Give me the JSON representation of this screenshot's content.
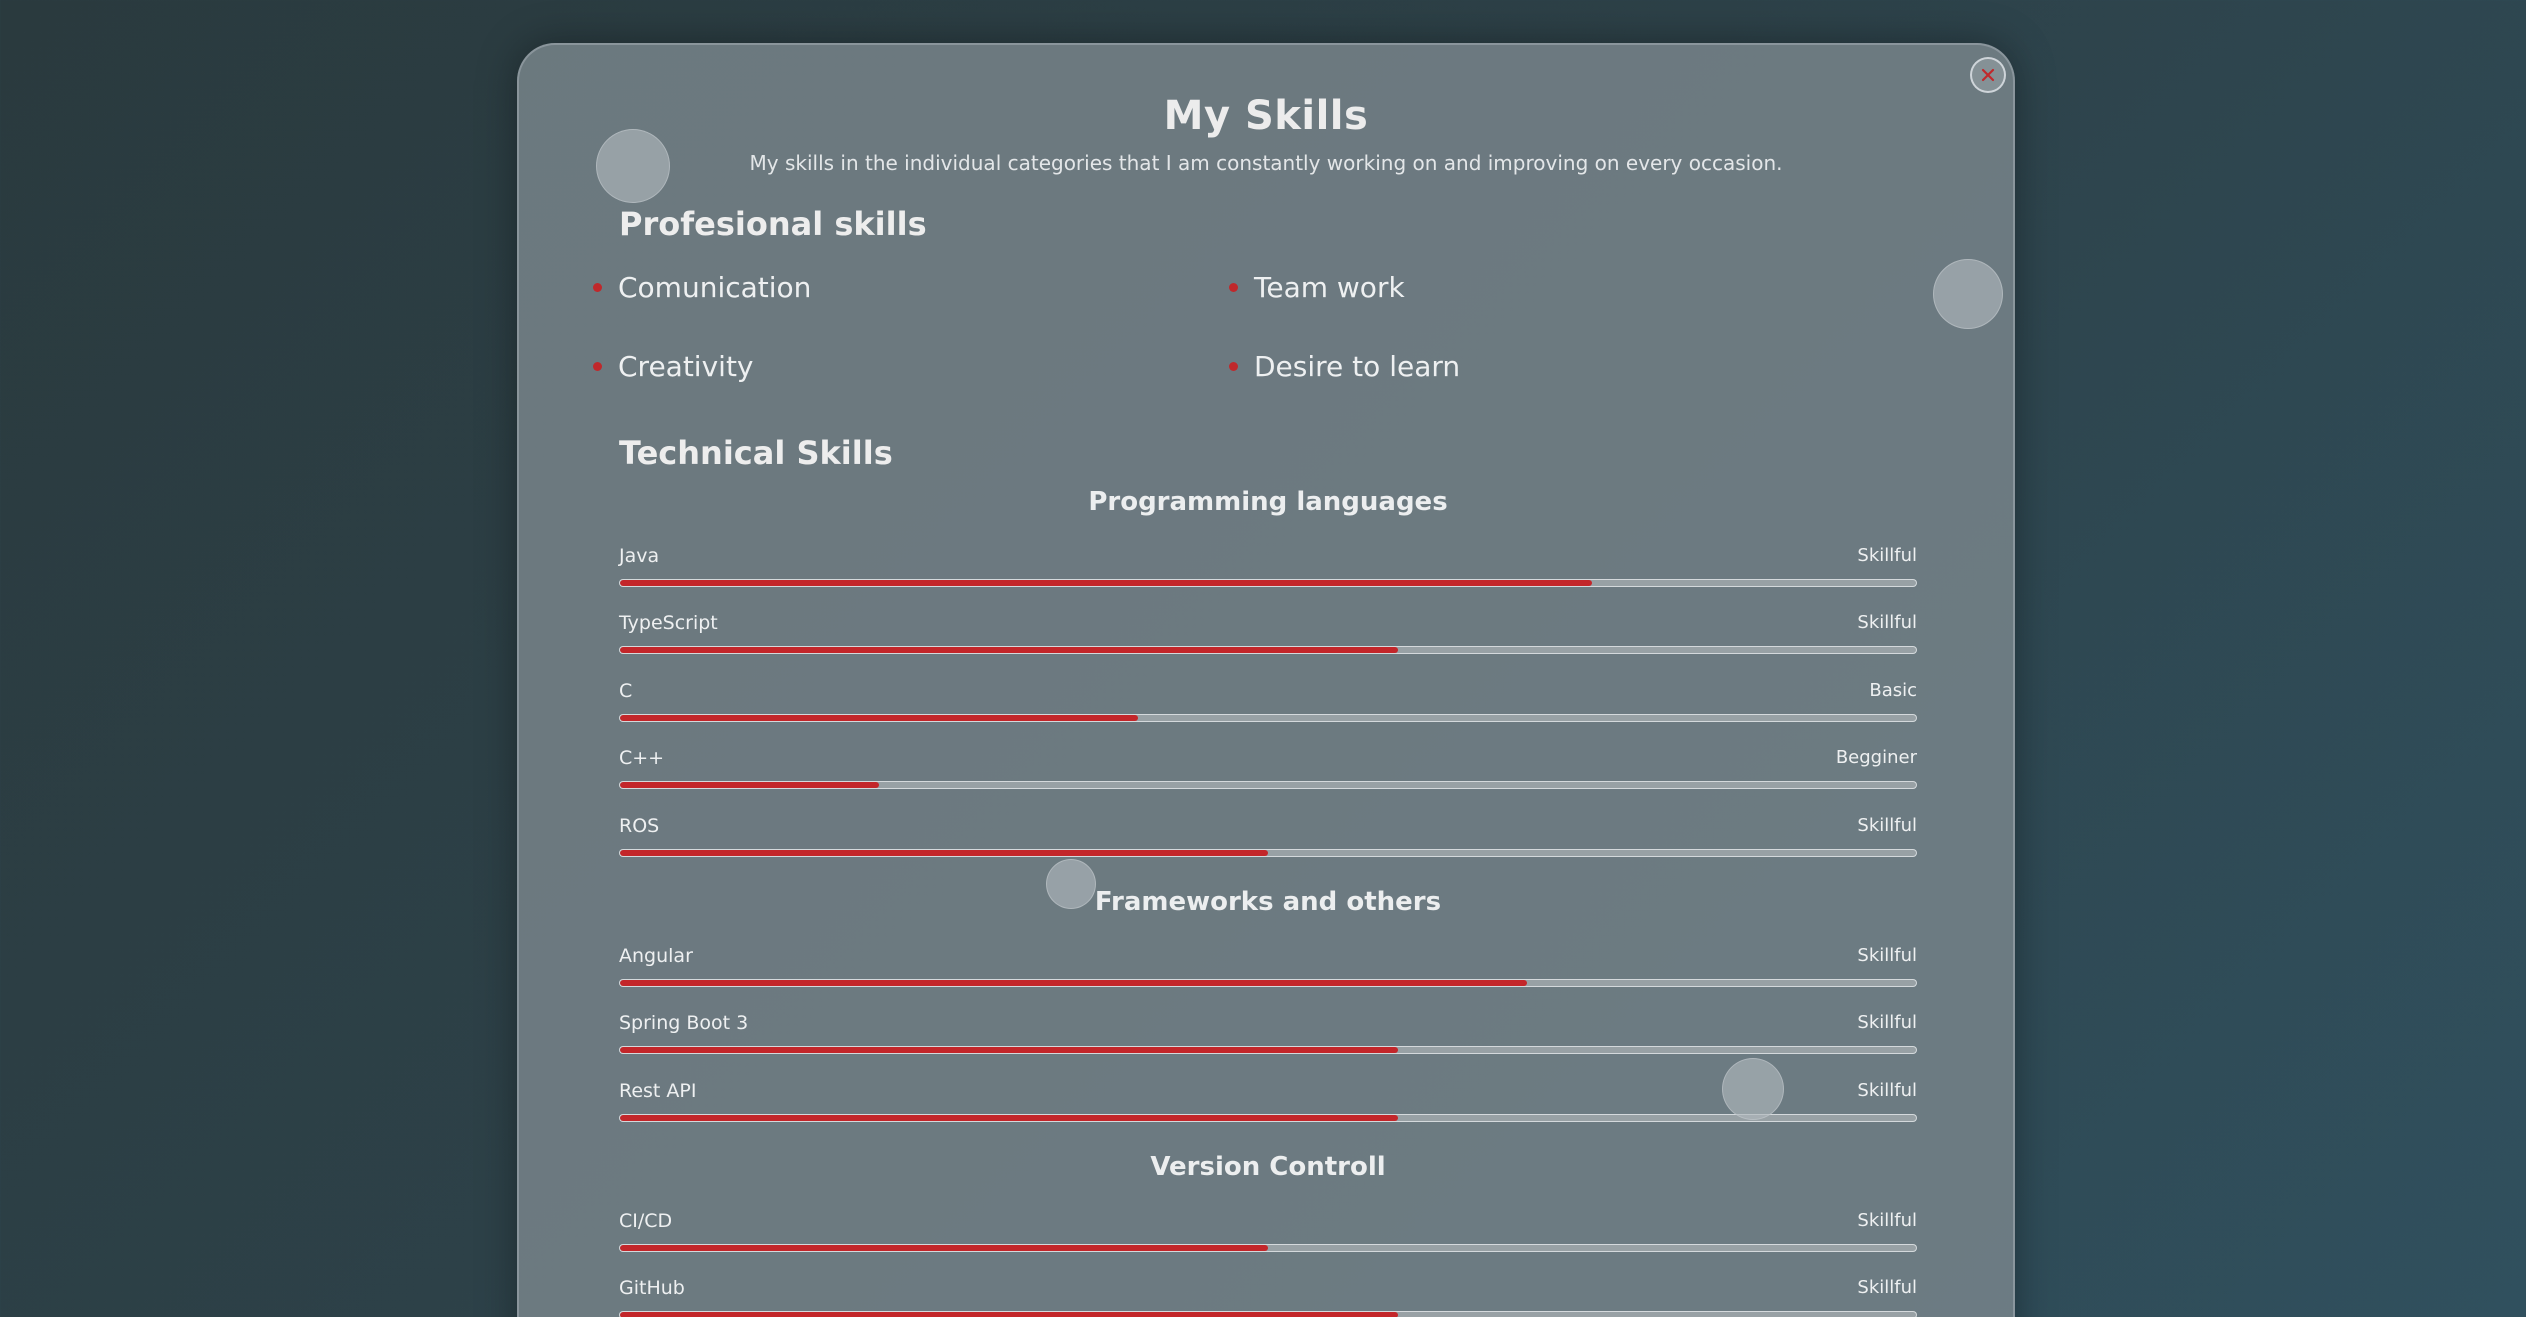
{
  "modal": {
    "title": "My Skills",
    "subtitle": "My skills in the individual categories that I am constantly working on and improving on every occasion.",
    "close_icon": "close-x-icon",
    "close_color": "#c0282b"
  },
  "professional": {
    "heading": "Profesional skills",
    "items": [
      {
        "label": "Comunication"
      },
      {
        "label": "Team work"
      },
      {
        "label": "Creativity"
      },
      {
        "label": "Desire to learn"
      }
    ]
  },
  "technical": {
    "heading": "Technical Skills",
    "categories": [
      {
        "title": "Programming languages",
        "skills": [
          {
            "name": "Java",
            "level": "Skillful",
            "progress": 75
          },
          {
            "name": "TypeScript",
            "level": "Skillful",
            "progress": 60
          },
          {
            "name": "C",
            "level": "Basic",
            "progress": 40
          },
          {
            "name": "C++",
            "level": "Begginer",
            "progress": 20
          },
          {
            "name": "ROS",
            "level": "Skillful",
            "progress": 50
          }
        ]
      },
      {
        "title": "Frameworks and others",
        "skills": [
          {
            "name": "Angular",
            "level": "Skillful",
            "progress": 70
          },
          {
            "name": "Spring Boot 3",
            "level": "Skillful",
            "progress": 60
          },
          {
            "name": "Rest API",
            "level": "Skillful",
            "progress": 60
          }
        ]
      },
      {
        "title": "Version Controll",
        "skills": [
          {
            "name": "CI/CD",
            "level": "Skillful",
            "progress": 50
          },
          {
            "name": "GitHub",
            "level": "Skillful",
            "progress": 60
          }
        ]
      }
    ]
  },
  "colors": {
    "accent": "#c3262a",
    "panel": "#7a868c"
  }
}
